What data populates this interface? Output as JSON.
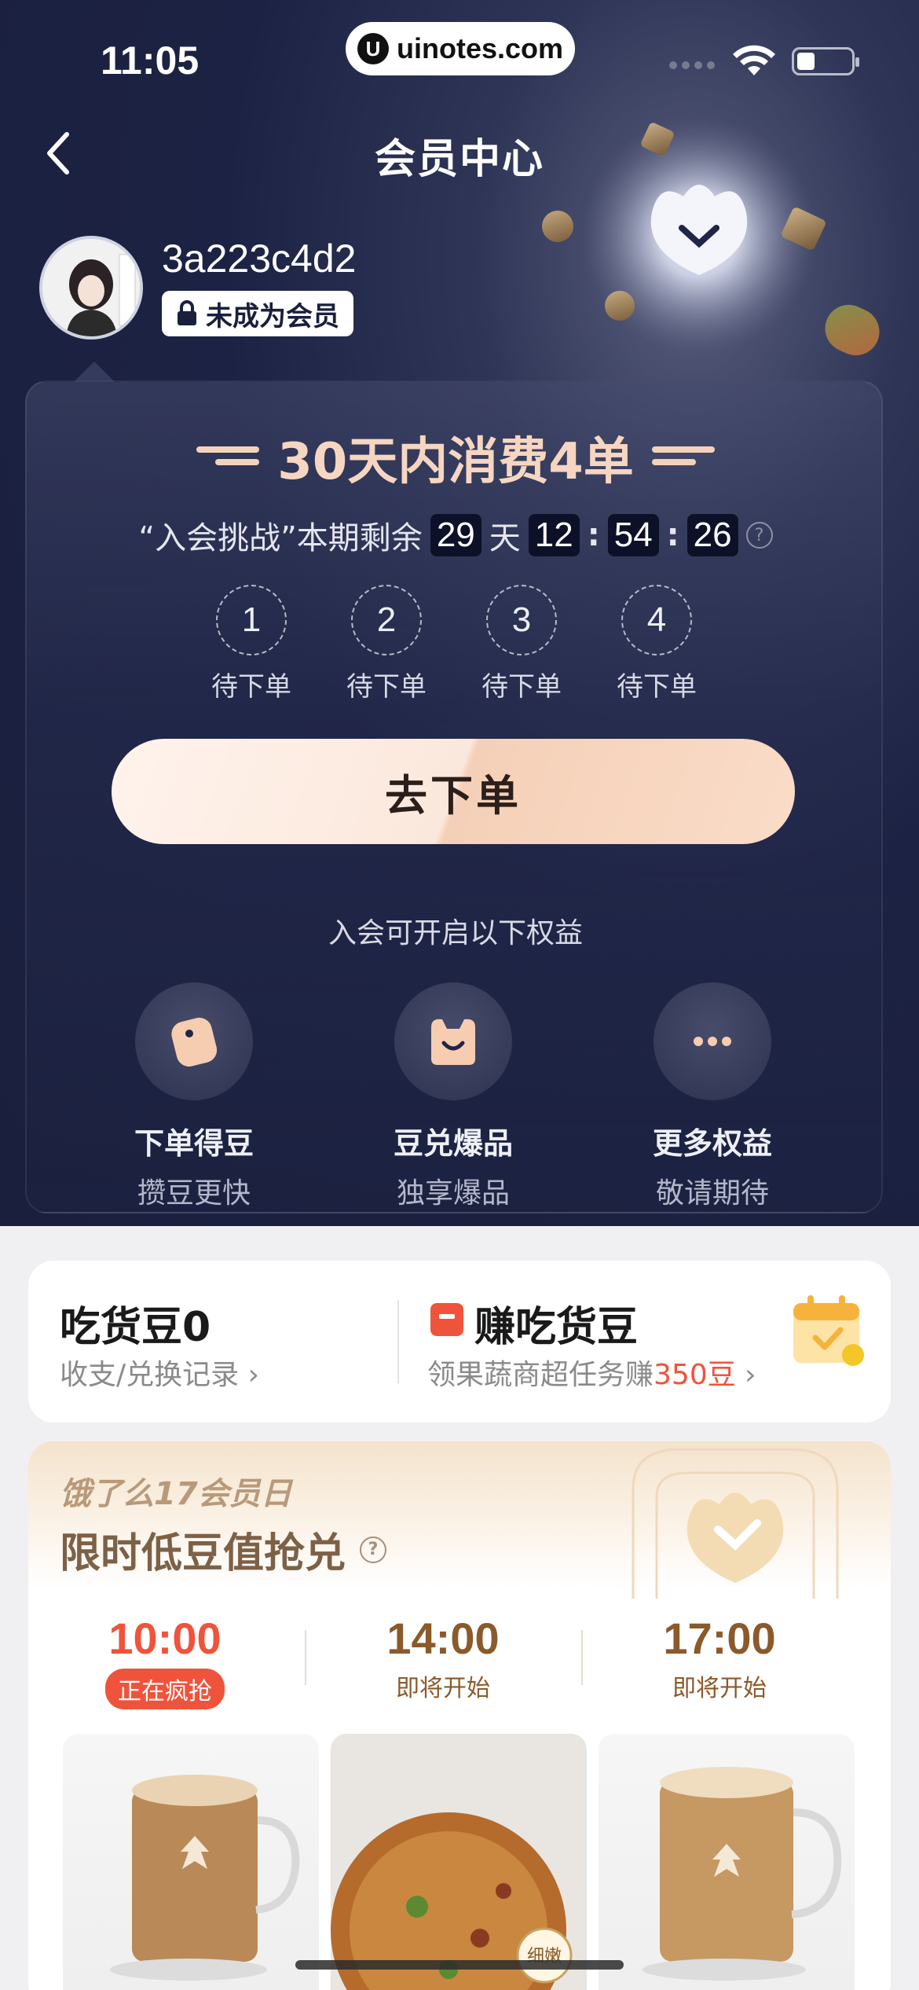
{
  "status_bar": {
    "time": "11:05",
    "url": "uinotes.com",
    "url_logo": "U"
  },
  "nav": {
    "title": "会员中心"
  },
  "profile": {
    "username": "3a223c4d2",
    "member_status": "未成为会员"
  },
  "challenge": {
    "title": "30天内消费4单",
    "countdown_label": "“入会挑战”本期剩余",
    "days": "29",
    "days_unit": "天",
    "hours": "12",
    "minutes": "54",
    "seconds": "26",
    "steps": [
      {
        "num": "1",
        "label": "待下单"
      },
      {
        "num": "2",
        "label": "待下单"
      },
      {
        "num": "3",
        "label": "待下单"
      },
      {
        "num": "4",
        "label": "待下单"
      }
    ],
    "order_button": "去下单",
    "benefits_intro": "入会可开启以下权益",
    "benefits": [
      {
        "name": "下单得豆",
        "sub": "攒豆更快",
        "icon": "bean-icon"
      },
      {
        "name": "豆兑爆品",
        "sub": "独享爆品",
        "icon": "gift-icon"
      },
      {
        "name": "更多权益",
        "sub": "敬请期待",
        "icon": "more-icon"
      }
    ]
  },
  "beans": {
    "title": "吃货豆0",
    "records_link": "收支/兑换记录",
    "earn_title": "赚吃货豆",
    "earn_sub_prefix": "领果蔬商超任务赚",
    "earn_sub_highlight": "350豆"
  },
  "flash_sale": {
    "tag": "饿了么17会员日",
    "title": "限时低豆值抢兑",
    "slots": [
      {
        "time": "10:00",
        "status": "正在疯抢",
        "active": true
      },
      {
        "time": "14:00",
        "status": "即将开始",
        "active": false
      },
      {
        "time": "17:00",
        "status": "即将开始",
        "active": false
      }
    ],
    "product_badge": "细嫩"
  },
  "colors": {
    "accent": "#f0533b",
    "peach": "#f6d6c0",
    "hero_bg": "#1a2040"
  }
}
